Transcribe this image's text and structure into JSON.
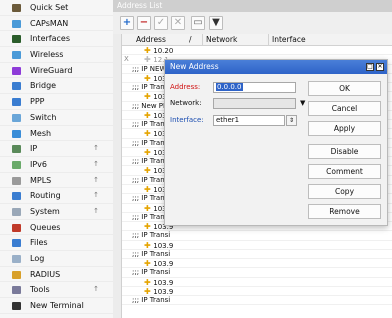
{
  "sidebar": {
    "items": [
      {
        "label": "Quick Set",
        "color": "#6b5a3a",
        "arrow": false
      },
      {
        "label": "CAPsMAN",
        "color": "#4a9ad8",
        "arrow": false
      },
      {
        "label": "Interfaces",
        "color": "#2b5d2b",
        "arrow": false
      },
      {
        "label": "Wireless",
        "color": "#4a9ad8",
        "arrow": false
      },
      {
        "label": "WireGuard",
        "color": "#8e3bd8",
        "arrow": false
      },
      {
        "label": "Bridge",
        "color": "#3a7dd1",
        "arrow": false
      },
      {
        "label": "PPP",
        "color": "#3a7dd1",
        "arrow": false
      },
      {
        "label": "Switch",
        "color": "#6aa6d8",
        "arrow": false
      },
      {
        "label": "Mesh",
        "color": "#3a8dd8",
        "arrow": false
      },
      {
        "label": "IP",
        "color": "#5a8a5a",
        "arrow": true
      },
      {
        "label": "IPv6",
        "color": "#6aaa6a",
        "arrow": true
      },
      {
        "label": "MPLS",
        "color": "#9a9a9a",
        "arrow": true
      },
      {
        "label": "Routing",
        "color": "#3a7dd1",
        "arrow": true
      },
      {
        "label": "System",
        "color": "#9aa8b8",
        "arrow": true
      },
      {
        "label": "Queues",
        "color": "#c03a2a",
        "arrow": false
      },
      {
        "label": "Files",
        "color": "#3a7dd1",
        "arrow": false
      },
      {
        "label": "Log",
        "color": "#9ab0c8",
        "arrow": false
      },
      {
        "label": "RADIUS",
        "color": "#d8a02a",
        "arrow": false
      },
      {
        "label": "Tools",
        "color": "#7a7a9a",
        "arrow": true
      },
      {
        "label": "New Terminal",
        "color": "#333333",
        "arrow": false
      }
    ],
    "arrow_glyph": "↑"
  },
  "address_list": {
    "title": "Address List",
    "columns": {
      "address": "Address",
      "network": "Network",
      "interface": "Interface",
      "sort_mark": "/"
    },
    "rows": [
      {
        "kind": "addr",
        "flag": "",
        "text": "10.20"
      },
      {
        "kind": "addr",
        "flag": "X",
        "text": "12.1"
      },
      {
        "kind": "comment",
        "text": ";;; IP NEW"
      },
      {
        "kind": "addr",
        "flag": "",
        "text": "103.9"
      },
      {
        "kind": "comment",
        "text": ";;; IP Transi"
      },
      {
        "kind": "addr",
        "flag": "",
        "text": "103.9"
      },
      {
        "kind": "comment",
        "text": ";;; New PM"
      },
      {
        "kind": "addr",
        "flag": "",
        "text": "103.9"
      },
      {
        "kind": "comment",
        "text": ";;; IP Transi"
      },
      {
        "kind": "addr",
        "flag": "",
        "text": "103.9"
      },
      {
        "kind": "comment",
        "text": ";;; IP Transi"
      },
      {
        "kind": "addr",
        "flag": "",
        "text": "103.9"
      },
      {
        "kind": "comment",
        "text": ";;; IP Transi"
      },
      {
        "kind": "addr",
        "flag": "",
        "text": "103.9"
      },
      {
        "kind": "comment",
        "text": ";;; IP Transi"
      },
      {
        "kind": "addr",
        "flag": "",
        "text": "103.9"
      },
      {
        "kind": "comment",
        "text": ";;; IP Transi"
      },
      {
        "kind": "addr",
        "flag": "",
        "text": "103.9"
      },
      {
        "kind": "comment",
        "text": ";;; IP Transi"
      },
      {
        "kind": "addr",
        "flag": "",
        "text": "103.9"
      },
      {
        "kind": "comment",
        "text": ";;; IP Transi"
      },
      {
        "kind": "addr",
        "flag": "",
        "text": "103.9"
      },
      {
        "kind": "comment",
        "text": ";;; IP Transi"
      },
      {
        "kind": "addr",
        "flag": "",
        "text": "103.9"
      },
      {
        "kind": "comment",
        "text": ";;; IP Transi"
      },
      {
        "kind": "addr",
        "flag": "",
        "text": "103.9"
      },
      {
        "kind": "addr",
        "flag": "",
        "text": "103.9"
      },
      {
        "kind": "comment",
        "text": ";;; IP Transi"
      }
    ]
  },
  "dialog": {
    "title": "New Address",
    "address_label": "Address:",
    "address_value": "0.0.0.0",
    "network_label": "Network:",
    "network_value": "",
    "interface_label": "Interface:",
    "interface_value": "ether1",
    "buttons": {
      "ok": "OK",
      "cancel": "Cancel",
      "apply": "Apply",
      "disable": "Disable",
      "comment": "Comment",
      "copy": "Copy",
      "remove": "Remove"
    },
    "accent_color": "#2e63c8"
  }
}
